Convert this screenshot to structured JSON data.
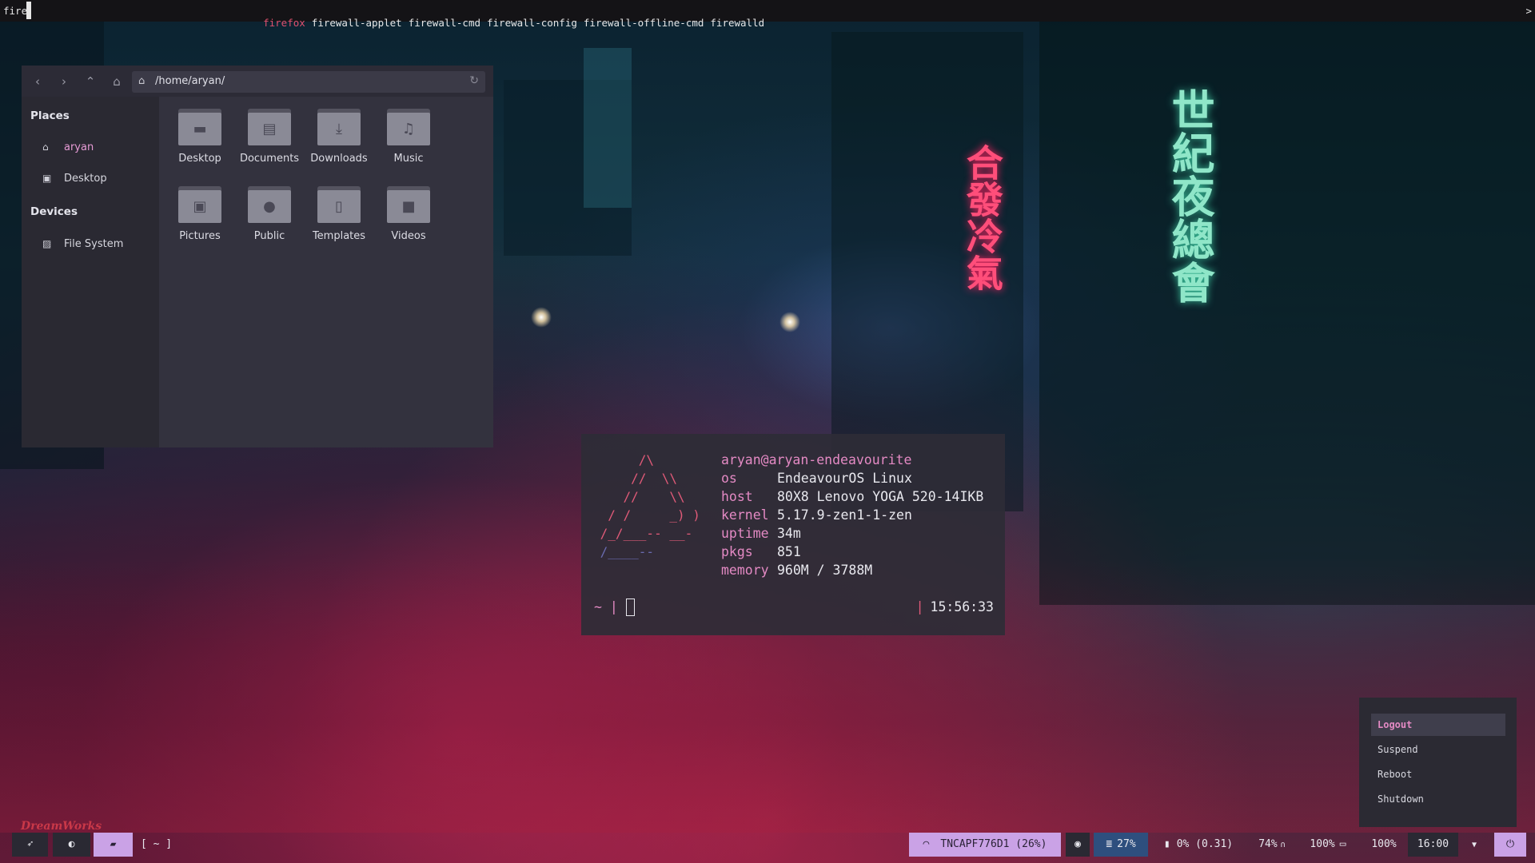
{
  "launcher": {
    "query": "fire",
    "results": [
      "firefox",
      "firewall-applet",
      "firewall-cmd",
      "firewall-config",
      "firewall-offline-cmd",
      "firewalld"
    ],
    "overflow": ">"
  },
  "file_manager": {
    "nav": {
      "back": "‹",
      "forward": "›",
      "up": "⌃",
      "home": "⌂"
    },
    "path": "/home/aryan/",
    "sidebar": {
      "places_header": "Places",
      "places": [
        {
          "label": "aryan",
          "icon": "home-icon"
        },
        {
          "label": "Desktop",
          "icon": "desktop-icon"
        }
      ],
      "devices_header": "Devices",
      "devices": [
        {
          "label": "File System",
          "icon": "drive-icon"
        }
      ]
    },
    "folders": [
      {
        "label": "Desktop",
        "glyph": "▬"
      },
      {
        "label": "Documents",
        "glyph": "▤"
      },
      {
        "label": "Downloads",
        "glyph": "⤓"
      },
      {
        "label": "Music",
        "glyph": "♫"
      },
      {
        "label": "Pictures",
        "glyph": "▣"
      },
      {
        "label": "Public",
        "glyph": "●"
      },
      {
        "label": "Templates",
        "glyph": "▯"
      },
      {
        "label": "Videos",
        "glyph": "■"
      }
    ]
  },
  "terminal": {
    "user_host": "aryan@aryan-endeavourite",
    "fields": [
      {
        "key": "os",
        "value": "EndeavourOS Linux"
      },
      {
        "key": "host",
        "value": "80X8 Lenovo YOGA 520-14IKB"
      },
      {
        "key": "kernel",
        "value": "5.17.9-zen1-1-zen"
      },
      {
        "key": "uptime",
        "value": "34m"
      },
      {
        "key": "pkgs",
        "value": "851"
      },
      {
        "key": "memory",
        "value": "960M / 3788M"
      }
    ],
    "prompt": "~ |",
    "time": "15:56:33",
    "ascii_lines": [
      "      /\\",
      "     //  \\\\",
      "    //    \\\\",
      "  / /     _) )",
      " /_/___-- __-",
      " /____--"
    ]
  },
  "power_menu": {
    "options": [
      "Logout",
      "Suspend",
      "Reboot",
      "Shutdown"
    ],
    "selected": "Logout"
  },
  "taskbar": {
    "workspace_label": "[ ~ ]",
    "wifi": "TNCAPF776D1 (26%)",
    "cpu": "27%",
    "load": "0% (0.31)",
    "volume": "74%",
    "battery": "100%",
    "brightness": "100%",
    "clock": "16:00"
  },
  "colors": {
    "accent_pink": "#e48ac4",
    "accent_red": "#e05a78",
    "pill_lilac": "#caa2e6"
  }
}
